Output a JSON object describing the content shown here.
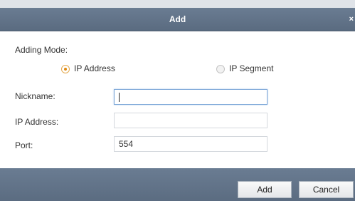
{
  "dialog": {
    "title": "Add",
    "close_glyph": "×"
  },
  "adding_mode": {
    "label": "Adding Mode:",
    "options": [
      {
        "label": "IP Address",
        "selected": true
      },
      {
        "label": "IP Segment",
        "selected": false
      }
    ]
  },
  "fields": {
    "nickname": {
      "label": "Nickname:",
      "value": ""
    },
    "ip_address": {
      "label": "IP Address:",
      "value": ""
    },
    "port": {
      "label": "Port:",
      "value": "554"
    }
  },
  "buttons": {
    "add": "Add",
    "cancel": "Cancel"
  },
  "colors": {
    "title_bar": "#5f7186",
    "radio_selected": "#e08a12",
    "focus_border": "#7ea8d8"
  },
  "icons": {
    "close": "close-icon",
    "radio_on": "radio-selected-icon",
    "radio_off": "radio-unselected-icon"
  }
}
